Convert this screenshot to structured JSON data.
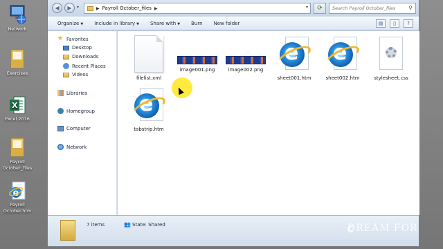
{
  "desktop": {
    "icons": [
      {
        "label": "Network"
      },
      {
        "label": "Exercises"
      },
      {
        "label": "Excel 2016"
      },
      {
        "label_line1": "Payroll",
        "label_line2": "October_files"
      },
      {
        "label_line1": "Payroll",
        "label_line2": "October.htm"
      }
    ]
  },
  "address": {
    "crumb": "Payroll October_files",
    "search_placeholder": "Search Payroll October_files"
  },
  "toolbar": {
    "organize": "Organize",
    "include_in_library": "Include in library",
    "share_with": "Share with",
    "burn": "Burn",
    "new_folder": "New folder"
  },
  "navpane": {
    "favorites": "Favorites",
    "desktop": "Desktop",
    "downloads": "Downloads",
    "recent_places": "Recent Places",
    "videos": "Videos",
    "libraries": "Libraries",
    "homegroup": "Homegroup",
    "computer": "Computer",
    "network": "Network"
  },
  "files": [
    {
      "name": "filelist.xml",
      "icon": "document-icon"
    },
    {
      "name": "image001.png",
      "icon": "image-thumbnail"
    },
    {
      "name": "image002.png",
      "icon": "image-thumbnail"
    },
    {
      "name": "sheet001.htm",
      "icon": "ie-icon"
    },
    {
      "name": "sheet002.htm",
      "icon": "ie-icon"
    },
    {
      "name": "stylesheet.css",
      "icon": "css-icon"
    },
    {
      "name": "tabstrip.htm",
      "icon": "ie-icon"
    }
  ],
  "details": {
    "item_count": "7 items",
    "state_label": "State:",
    "state_value": "Shared"
  },
  "watermark": "DREAM FOR"
}
